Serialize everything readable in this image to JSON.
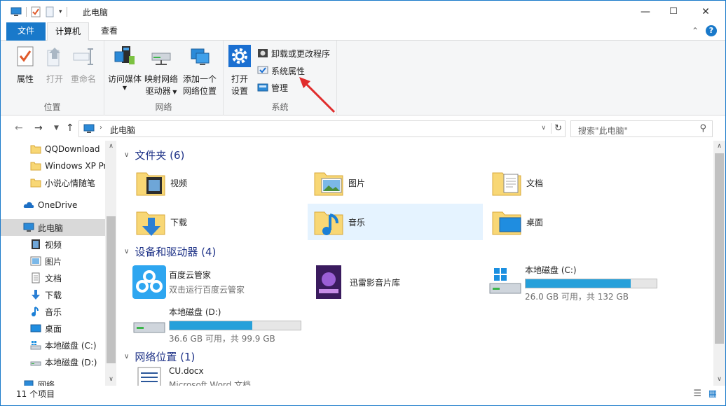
{
  "window": {
    "title": "此电脑",
    "controls": {
      "minimize": "—",
      "maximize": "☐",
      "close": "✕"
    }
  },
  "ribbon_tabs": {
    "file": "文件",
    "computer": "计算机",
    "view": "查看"
  },
  "ribbon": {
    "location": {
      "label": "位置",
      "properties": "属性",
      "open": "打开",
      "rename": "重命名"
    },
    "network": {
      "label": "网络",
      "access_media": "访问媒体",
      "map_drive_1": "映射网络",
      "map_drive_2": "驱动器",
      "add_location_1": "添加一个",
      "add_location_2": "网络位置"
    },
    "system": {
      "label": "系统",
      "open_settings_1": "打开",
      "open_settings_2": "设置",
      "uninstall": "卸载或更改程序",
      "sys_props": "系统属性",
      "manage": "管理"
    }
  },
  "address": {
    "path": "此电脑",
    "search_placeholder": "搜索\"此电脑\""
  },
  "nav": {
    "quick": [
      "QQDownload",
      "Windows XP Pr",
      "小说心情随笔"
    ],
    "onedrive": "OneDrive",
    "thispc": "此电脑",
    "children": [
      "视频",
      "图片",
      "文档",
      "下载",
      "音乐",
      "桌面",
      "本地磁盘 (C:)",
      "本地磁盘 (D:)"
    ],
    "network": "网络"
  },
  "content": {
    "folders_header": "文件夹 (6)",
    "folders": [
      "视频",
      "图片",
      "文档",
      "下载",
      "音乐",
      "桌面"
    ],
    "devices_header": "设备和驱动器 (4)",
    "devices": {
      "baidu_name": "百度云管家",
      "baidu_sub": "双击运行百度云管家",
      "xunlei_name": "迅雷影音片库",
      "c_name": "本地磁盘 (C:)",
      "c_free": "26.0 GB 可用，共 132 GB",
      "c_used_fraction": 0.8,
      "d_name": "本地磁盘 (D:)",
      "d_free": "36.6 GB 可用，共 99.9 GB",
      "d_used_fraction": 0.63
    },
    "network_header": "网络位置 (1)",
    "network_item": "CU.docx",
    "network_item_sub": "Microsoft Word 文档"
  },
  "status": {
    "count": "11 个项目"
  },
  "colors": {
    "accent": "#1979ca",
    "bar": "#26a0da",
    "header": "#1e3287",
    "arrow": "#e02d2d"
  }
}
